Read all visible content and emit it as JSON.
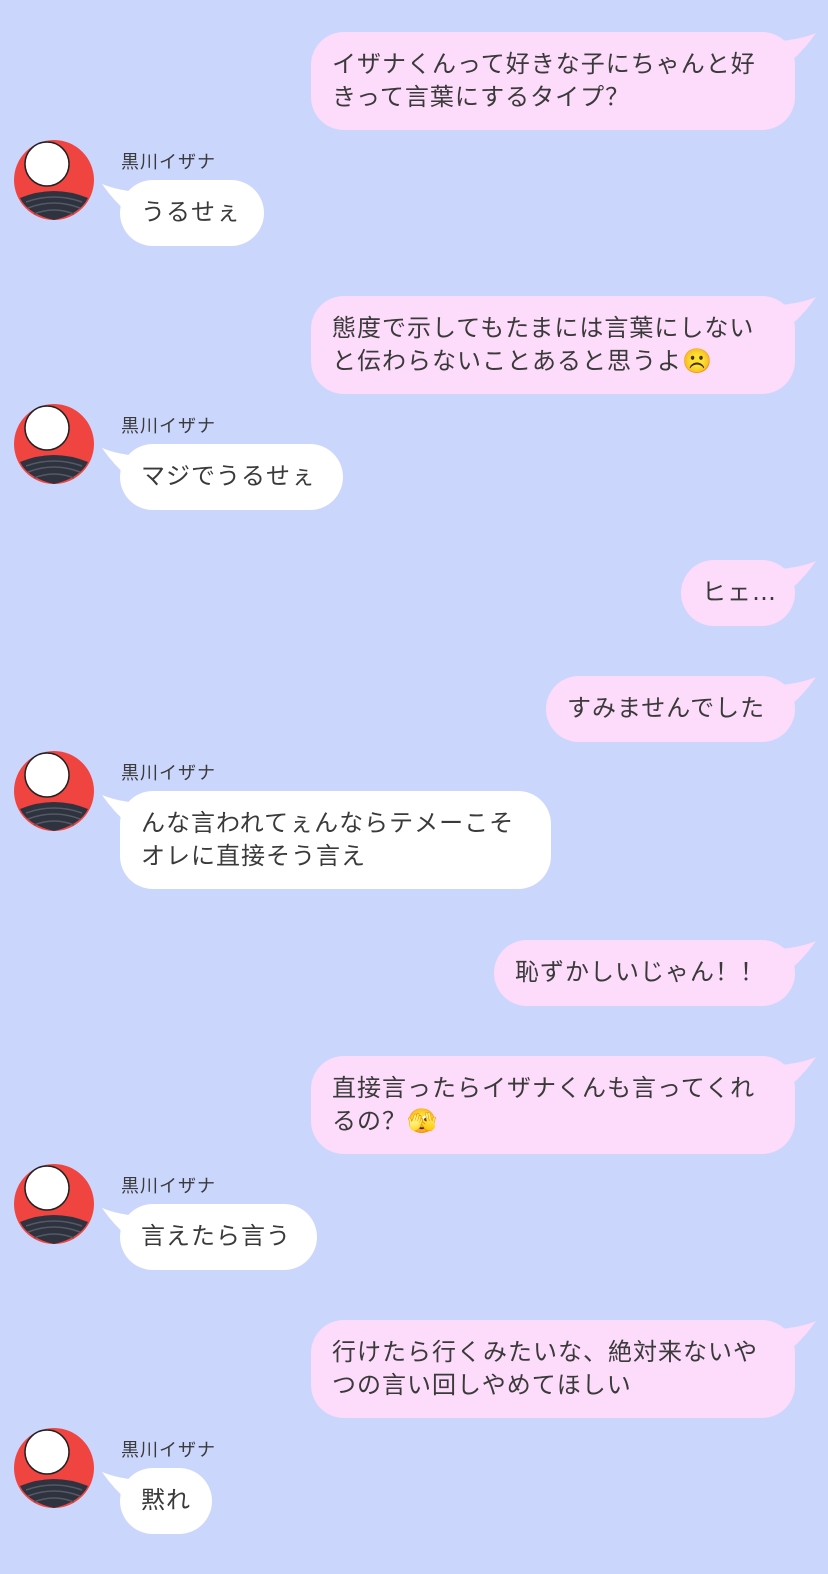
{
  "colors": {
    "background": "#cbd6fd",
    "my_bubble": "#fcdcfa",
    "their_bubble": "#ffffff",
    "avatar": "#f04440"
  },
  "contact": {
    "name": "黒川イザナ",
    "avatar_icon": "avatar-icon"
  },
  "messages": [
    {
      "side": "me",
      "text": "イザナくんって好きな子にちゃんと好\nきって言葉にするタイプ？"
    },
    {
      "side": "them",
      "text": "うるせぇ"
    },
    {
      "side": "me",
      "text": "態度で示してもたまには言葉にしない\nと伝わらないことあると思うよ☹️"
    },
    {
      "side": "them",
      "text": "マジでうるせぇ"
    },
    {
      "side": "me",
      "text": "ヒェ…"
    },
    {
      "side": "me",
      "text": "すみませんでした"
    },
    {
      "side": "them",
      "text": "んな言われてぇんならテメーこそ\nオレに直接そう言え"
    },
    {
      "side": "me",
      "text": "恥ずかしいじゃん！！"
    },
    {
      "side": "me",
      "text": "直接言ったらイザナくんも言ってくれ\nるの？🫣"
    },
    {
      "side": "them",
      "text": "言えたら言う"
    },
    {
      "side": "me",
      "text": "行けたら行くみたいな、絶対来ないや\nつの言い回しやめてほしい"
    },
    {
      "side": "them",
      "text": "黙れ"
    }
  ]
}
